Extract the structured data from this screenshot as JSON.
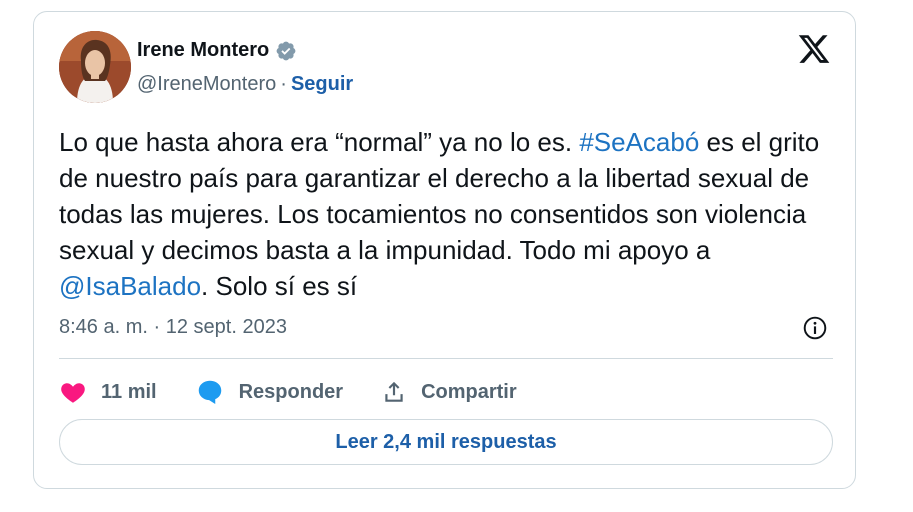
{
  "author": {
    "name": "Irene Montero",
    "handle": "@IreneMontero",
    "separator": "·",
    "follow_label": "Seguir",
    "verified_color": "#829aab"
  },
  "tweet": {
    "text_part1": "Lo que hasta ahora era “normal” ya no lo es. ",
    "hashtag": "#SeAcabó",
    "text_part2": " es el grito de nuestro país para garantizar el derecho a la libertad sexual de todas las mujeres. Los tocamientos no consentidos son violencia sexual y decimos basta a la impunidad. Todo mi apoyo a ",
    "mention": "@IsaBalado",
    "text_part3": ". Solo sí es sí",
    "link_color": "#1d73c2"
  },
  "meta": {
    "time": "8:46 a. m.",
    "separator": "·",
    "date": "12 sept. 2023"
  },
  "actions": {
    "likes": "11 mil",
    "reply_label": "Responder",
    "share_label": "Compartir",
    "like_color": "#f91880",
    "reply_color": "#1d9bf0"
  },
  "replies_button": {
    "label": "Leer 2,4 mil respuestas"
  },
  "icons": {
    "logo": "x-logo-icon",
    "verified": "verified-badge-icon",
    "info": "info-icon",
    "like": "heart-icon",
    "reply": "speech-bubble-icon",
    "share": "share-icon"
  }
}
